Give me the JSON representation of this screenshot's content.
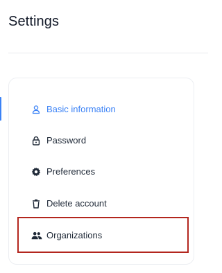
{
  "page": {
    "title": "Settings"
  },
  "nav": {
    "items": [
      {
        "label": "Basic information",
        "icon": "user-icon",
        "active": true
      },
      {
        "label": "Password",
        "icon": "lock-icon",
        "active": false
      },
      {
        "label": "Preferences",
        "icon": "gear-icon",
        "active": false
      },
      {
        "label": "Delete account",
        "icon": "trash-icon",
        "active": false
      },
      {
        "label": "Organizations",
        "icon": "people-icon",
        "active": false
      }
    ]
  },
  "colors": {
    "accent": "#3b82f6",
    "highlight_border": "#b3261e",
    "text": "#1f2937"
  }
}
